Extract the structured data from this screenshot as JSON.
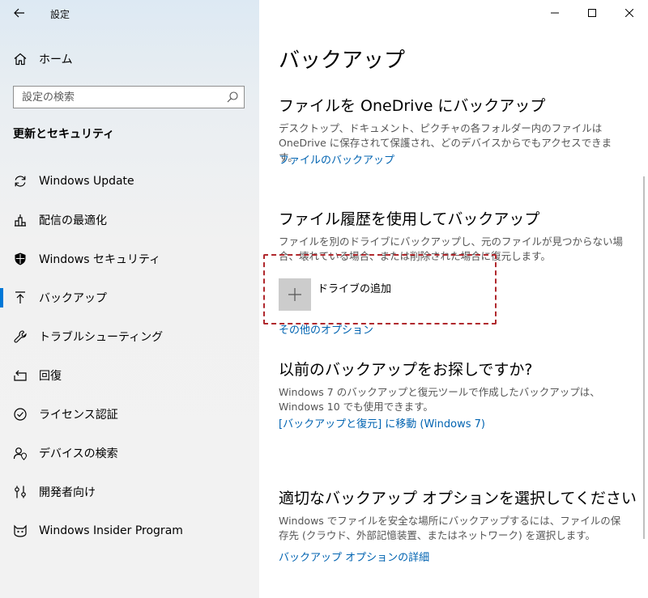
{
  "window": {
    "title": "設定"
  },
  "sidebar": {
    "home_label": "ホーム",
    "search_placeholder": "設定の検索",
    "section_title": "更新とセキュリティ",
    "items": [
      {
        "label": "Windows Update",
        "icon": "refresh-icon"
      },
      {
        "label": "配信の最適化",
        "icon": "delivery-optimization-icon"
      },
      {
        "label": "Windows セキュリティ",
        "icon": "shield-icon"
      },
      {
        "label": "バックアップ",
        "icon": "backup-arrow-icon",
        "active": true
      },
      {
        "label": "トラブルシューティング",
        "icon": "wrench-icon"
      },
      {
        "label": "回復",
        "icon": "recovery-icon"
      },
      {
        "label": "ライセンス認証",
        "icon": "check-circle-icon"
      },
      {
        "label": "デバイスの検索",
        "icon": "person-location-icon"
      },
      {
        "label": "開発者向け",
        "icon": "developer-icon"
      },
      {
        "label": "Windows Insider Program",
        "icon": "insider-cat-icon"
      }
    ]
  },
  "main": {
    "title": "バックアップ",
    "onedrive": {
      "heading": "ファイルを OneDrive にバックアップ",
      "desc": "デスクトップ、ドキュメント、ピクチャの各フォルダー内のファイルは OneDrive に保存されて保護され、どのデバイスからでもアクセスできます。",
      "link": "ファイルのバックアップ"
    },
    "file_history": {
      "heading": "ファイル履歴を使用してバックアップ",
      "desc": "ファイルを別のドライブにバックアップし、元のファイルが見つからない場合、壊れている場合、または削除された場合に復元します。",
      "add_drive_label": "ドライブの追加",
      "more_options_link": "その他のオプション"
    },
    "older_backup": {
      "heading": "以前のバックアップをお探しですか?",
      "desc": "Windows 7 のバックアップと復元ツールで作成したバックアップは、Windows 10 でも使用できます。",
      "link": "[バックアップと復元] に移動 (Windows 7)"
    },
    "choose_option": {
      "heading": "適切なバックアップ オプションを選択してください",
      "desc": "Windows でファイルを安全な場所にバックアップするには、ファイルの保存先 (クラウド、外部記憶装置、またはネットワーク) を選択します。",
      "link": "バックアップ オプションの詳細"
    }
  },
  "colors": {
    "accent": "#0078d7",
    "link": "#0063b1",
    "highlight_border": "#b0282d"
  }
}
